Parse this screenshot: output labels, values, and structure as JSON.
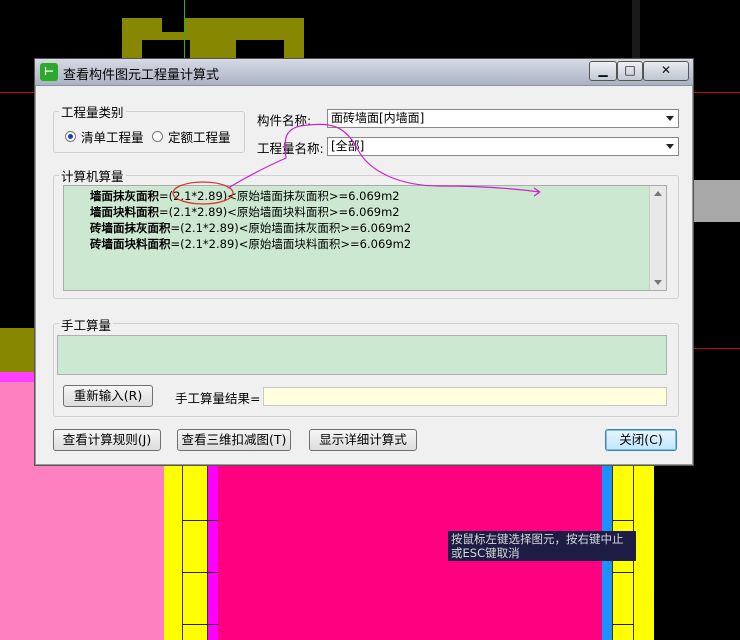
{
  "window": {
    "title": "查看构件图元工程量计算式",
    "app_icon": "⊢"
  },
  "controls": {
    "minimize": "▁",
    "maximize": "□",
    "close": "✕"
  },
  "quantity_type": {
    "label": "工程量类别",
    "options": [
      {
        "label": "清单工程量",
        "selected": true
      },
      {
        "label": "定额工程量",
        "selected": false
      }
    ]
  },
  "component_name": {
    "label": "构件名称:",
    "value": "面砖墙面[内墙面]"
  },
  "quantity_name": {
    "label": "工程量名称:",
    "value": "[全部]"
  },
  "computer_calc": {
    "label": "计算机算量",
    "lines": [
      {
        "name": "墙面抹灰面积",
        "formula": "=(2.1*2.89)<原始墙面抹灰面积>=6.069m2"
      },
      {
        "name": "墙面块料面积",
        "formula": "=(2.1*2.89)<原始墙面块料面积>=6.069m2"
      },
      {
        "name": "砖墙面抹灰面积",
        "formula": "=(2.1*2.89)<原始墙面抹灰面积>=6.069m2"
      },
      {
        "name": "砖墙面块料面积",
        "formula": "=(2.1*2.89)<原始墙面块料面积>=6.069m2"
      }
    ]
  },
  "manual_calc": {
    "label": "手工算量",
    "reenter_button": "重新输入(R)",
    "result_label": "手工算量结果=",
    "result_value": ""
  },
  "buttons": {
    "view_rules": "查看计算规则(J)",
    "view_3d": "查看三维扣减图(T)",
    "show_detail": "显示详细计算式",
    "close": "关闭(C)"
  },
  "tooltip": {
    "line1": "按鼠标左键选择图元，按右键中止",
    "line2": "或ESC键取消"
  },
  "colors": {
    "calc_bg": "#cce8d0",
    "annotation": "#cc22cc",
    "circle": "#dd3333",
    "magenta": "#ff0080",
    "pink": "#ff80c0",
    "yellow": "#ffff00"
  }
}
